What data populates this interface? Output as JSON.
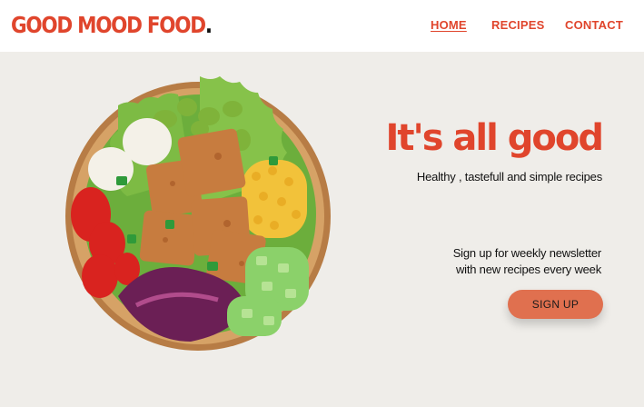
{
  "header": {
    "logo_text": "GOOD MOOD FOOD",
    "logo_dot": ".",
    "nav": [
      {
        "label": "HOME",
        "active": true
      },
      {
        "label": "RECIPES",
        "active": false
      },
      {
        "label": "CONTACT",
        "active": false
      }
    ]
  },
  "hero": {
    "headline": "It's all good",
    "subheadline": "Healthy , tastefull and simple recipes",
    "newsletter_line1": "Sign up for weekly newsletter",
    "newsletter_line2": "with new recipes every week",
    "signup_label": "SIGN UP",
    "image_icon": "salad-bowl-photo"
  },
  "colors": {
    "accent": "#e0452c",
    "button": "#e0704f",
    "background": "#efede9",
    "header_bg": "#ffffff"
  }
}
